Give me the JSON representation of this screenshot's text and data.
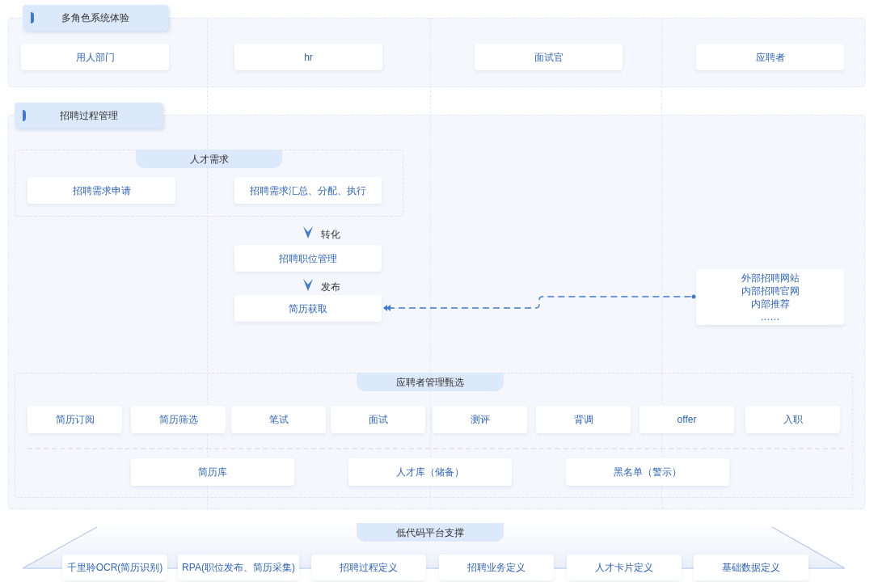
{
  "roles_section": {
    "title": "多角色系统体验",
    "roles": [
      "用人部门",
      "hr",
      "面试官",
      "应聘者"
    ]
  },
  "process_section": {
    "title": "招聘过程管理",
    "talent_demand": {
      "title": "人才需求",
      "items": [
        "招聘需求申请",
        "招聘需求汇总、分配、执行"
      ]
    },
    "flow": [
      {
        "label": "转化",
        "node": "招聘职位管理"
      },
      {
        "label": "发布",
        "node": "简历获取"
      }
    ],
    "sources": [
      "外部招聘网站",
      "内部招聘官网",
      "内部推荐",
      "……"
    ],
    "screening": {
      "title": "应聘者管理甄选",
      "steps": [
        "简历订阅",
        "简历筛选",
        "笔试",
        "面试",
        "测评",
        "背调",
        "offer",
        "入职"
      ],
      "pools": [
        "简历库",
        "人才库（储备）",
        "黑名单（警示）"
      ]
    }
  },
  "platform": {
    "title": "低代码平台支撑",
    "items": [
      "千里聆OCR(简历识别)",
      "RPA(职位发布、简历采集)",
      "招聘过程定义",
      "招聘业务定义",
      "人才卡片定义",
      "基础数据定义"
    ]
  }
}
